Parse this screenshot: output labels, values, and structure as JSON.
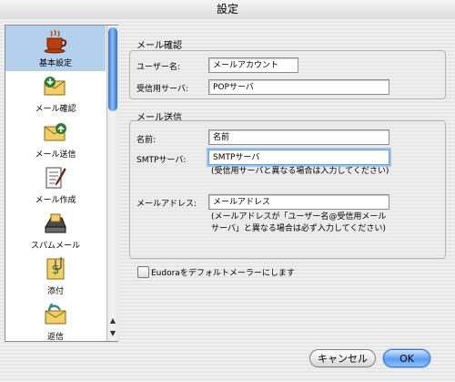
{
  "window": {
    "title": "設定"
  },
  "sidebar": {
    "items": [
      {
        "label": "基本設定",
        "icon": "coffee-cup-icon",
        "selected": true
      },
      {
        "label": "メール確認",
        "icon": "check-mail-icon",
        "selected": false
      },
      {
        "label": "メール送信",
        "icon": "send-mail-icon",
        "selected": false
      },
      {
        "label": "メール作成",
        "icon": "compose-mail-icon",
        "selected": false
      },
      {
        "label": "スパムメール",
        "icon": "spam-mail-icon",
        "selected": false
      },
      {
        "label": "添付",
        "icon": "attachment-icon",
        "selected": false
      },
      {
        "label": "返信",
        "icon": "reply-icon",
        "selected": false
      }
    ]
  },
  "mail_check": {
    "title": "メール確認",
    "username_label": "ユーザー名:",
    "username_value": "メールアカウント",
    "incoming_server_label": "受信用サーバ:",
    "incoming_server_value": "POPサーバ"
  },
  "mail_send": {
    "title": "メール送信",
    "name_label": "名前:",
    "name_value": "名前",
    "smtp_label": "SMTPサーバ:",
    "smtp_value": "SMTPサーバ",
    "smtp_hint": "(受信用サーバと異なる場合は入力してください)",
    "email_label": "メールアドレス:",
    "email_value": "メールアドレス",
    "email_hint_line1": "(メールアドレスが「ユーザー名@受信用メール",
    "email_hint_line2": "サーバ」と異なる場合は必ず入力してください)"
  },
  "default_mailer": {
    "label": "Eudoraをデフォルトメーラーにします",
    "checked": false
  },
  "buttons": {
    "cancel": "キャンセル",
    "ok": "OK"
  },
  "colors": {
    "accent": "#3f8ae6",
    "selection": "#b5d0ec"
  }
}
